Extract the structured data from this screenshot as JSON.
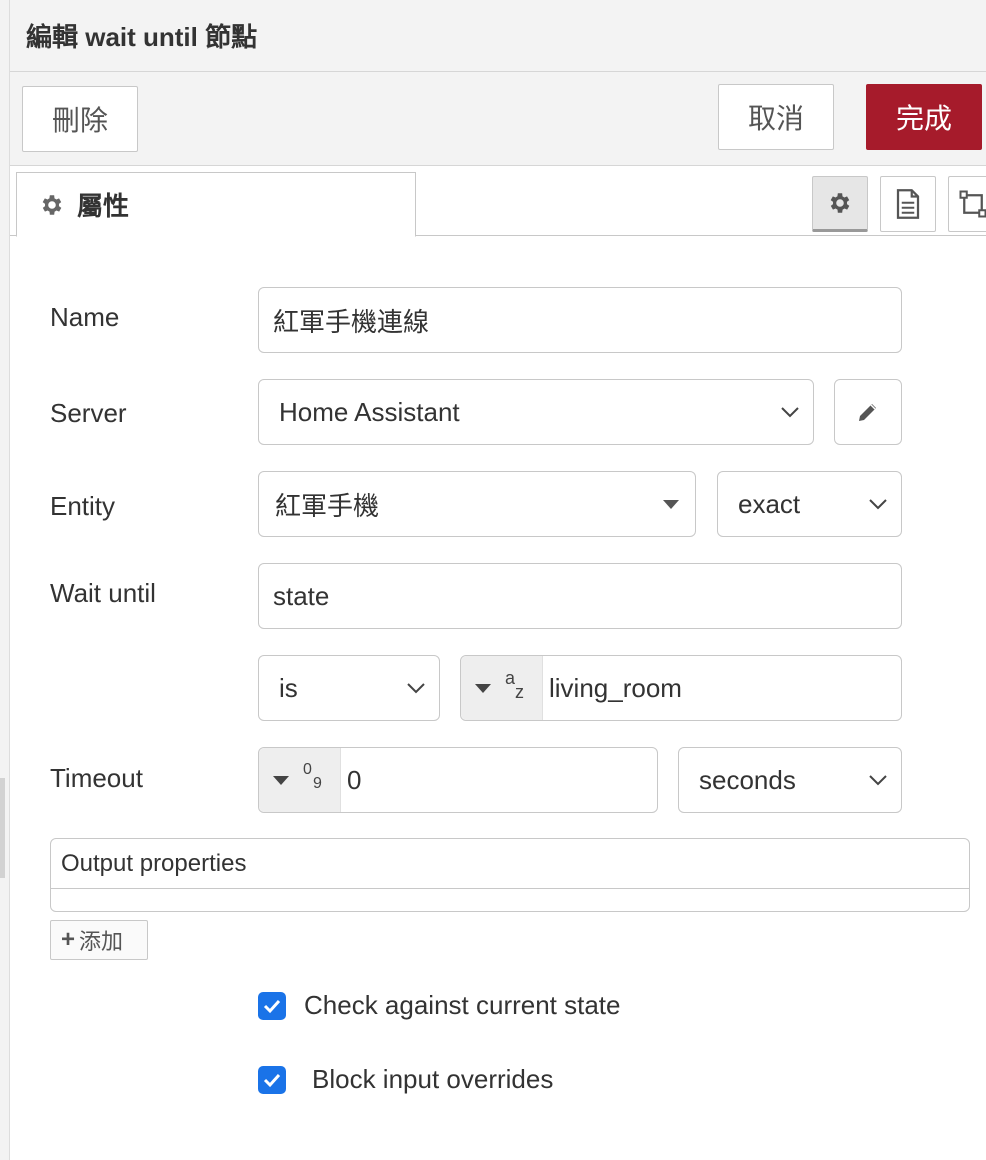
{
  "dialog": {
    "title": "編輯 wait until 節點"
  },
  "tray": {
    "delete_label": "刪除",
    "cancel_label": "取消",
    "done_label": "完成",
    "done_color": "#a61b2b"
  },
  "tabs": {
    "active_label": "屬性",
    "icons": [
      "gear-icon",
      "document-icon",
      "appearance-icon"
    ]
  },
  "form": {
    "name": {
      "label": "Name",
      "value": "紅軍手機連線"
    },
    "server": {
      "label": "Server",
      "value": "Home Assistant"
    },
    "entity": {
      "label": "Entity",
      "value": "紅軍手機",
      "match": "exact"
    },
    "wait_until": {
      "label": "Wait until",
      "property": "state",
      "comparator": "is",
      "value_type": "a z",
      "value": "living_room"
    },
    "timeout": {
      "label": "Timeout",
      "value_type": "0 9",
      "value": "0",
      "units": "seconds"
    },
    "output_properties": {
      "label": "Output properties",
      "add_label": "添加"
    },
    "check_current_state": {
      "label": "Check against current state",
      "checked": true
    },
    "block_input_overrides": {
      "label": "Block input overrides",
      "checked": true
    }
  },
  "colors": {
    "checkbox": "#1a73e8",
    "border": "#c8c8c8"
  }
}
